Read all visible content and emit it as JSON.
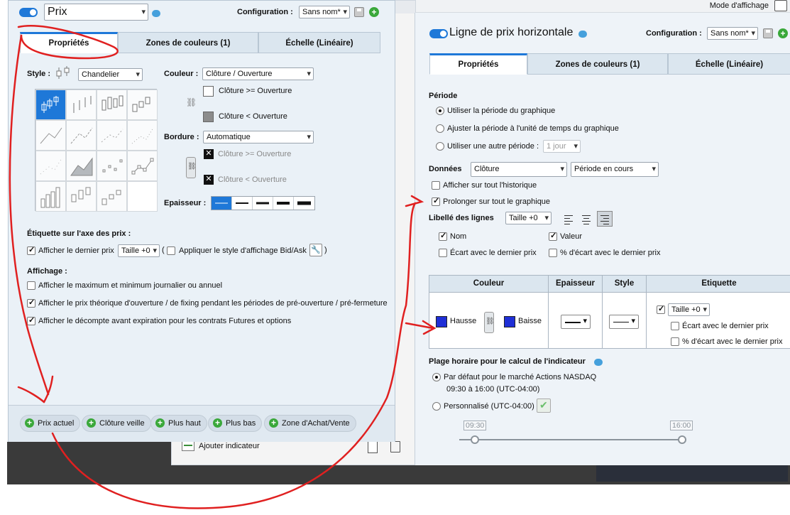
{
  "top_strip": {
    "mode_label": "Mode d'affichage"
  },
  "back_panel": {
    "add_indicator_label": "Ajouter indicateur"
  },
  "left_dialog": {
    "title": "Prix",
    "config_label": "Configuration :",
    "config_value": "Sans nom*",
    "tabs": [
      {
        "label": "Propriétés",
        "active": true
      },
      {
        "label": "Zones de couleurs (1)",
        "active": false
      },
      {
        "label": "Échelle (Linéaire)",
        "active": false
      }
    ],
    "style_label": "Style :",
    "style_value": "Chandelier",
    "couleur_label": "Couleur :",
    "couleur_value": "Clôture / Ouverture",
    "color_up_label": "Clôture >= Ouverture",
    "color_down_label": "Clôture < Ouverture",
    "bordure_label": "Bordure :",
    "bordure_value": "Automatique",
    "border_up_label": "Clôture >= Ouverture",
    "border_down_label": "Clôture < Ouverture",
    "epaisseur_label": "Epaisseur :",
    "axis_section_title": "Étiquette sur l'axe des prix :",
    "show_last_price_label": "Afficher le dernier prix",
    "last_price_size": "Taille +0",
    "paren_open": "(",
    "apply_bidask_label": "Appliquer le style d'affichage Bid/Ask",
    "paren_close": ")",
    "affichage_title": "Affichage :",
    "options": [
      {
        "label": "Afficher le maximum et minimum journalier ou annuel",
        "checked": false
      },
      {
        "label": "Afficher le prix théorique d'ouverture / de fixing pendant les périodes de pré-ouverture / pré-fermeture",
        "checked": true
      },
      {
        "label": "Afficher le décompte avant expiration pour les contrats Futures et options",
        "checked": true
      }
    ],
    "bottom_buttons": [
      "Prix actuel",
      "Clôture veille",
      "Plus haut",
      "Plus bas",
      "Zone d'Achat/Vente"
    ]
  },
  "right_dialog": {
    "title": "Ligne de prix horizontale",
    "config_label": "Configuration :",
    "config_value": "Sans nom*",
    "tabs": [
      {
        "label": "Propriétés",
        "active": true
      },
      {
        "label": "Zones de couleurs (1)",
        "active": false
      },
      {
        "label": "Échelle (Linéaire)",
        "active": false
      }
    ],
    "periode_title": "Période",
    "periode_options": [
      {
        "label": "Utiliser la période du graphique",
        "selected": true
      },
      {
        "label": "Ajuster la période à l'unité de temps du graphique",
        "selected": false
      },
      {
        "label": "Utiliser une autre période :",
        "selected": false
      }
    ],
    "other_period_value": "1 jour",
    "donnees_label": "Données",
    "donnees_value": "Clôture",
    "donnees_period_value": "Période en cours",
    "history_label": "Afficher sur tout l'historique",
    "history_checked": false,
    "extend_label": "Prolonger sur tout le graphique",
    "extend_checked": true,
    "libelle_label": "Libellé des lignes",
    "libelle_size": "Taille +0",
    "nom_label": "Nom",
    "valeur_label": "Valeur",
    "ecart_label": "Écart avec le dernier prix",
    "pct_ecart_label": "% d'écart avec le dernier prix",
    "table_headers": [
      "Couleur",
      "Epaisseur",
      "Style",
      "Etiquette"
    ],
    "hausse_label": "Hausse",
    "baisse_label": "Baisse",
    "etiquette_size": "Taille +0",
    "etiquette_ecart_label": "Écart avec le dernier prix",
    "etiquette_pct_label": "% d'écart avec le dernier prix",
    "plage_title": "Plage horaire pour le calcul de l'indicateur",
    "default_market_label": "Par défaut pour le marché Actions NASDAQ",
    "default_hours": "09:30 à 16:00 (UTC-04:00)",
    "custom_label": "Personnalisé (UTC-04:00)",
    "start_time": "09:30",
    "end_time": "16:00"
  },
  "colors": {
    "accent": "#1e78d8",
    "annotation_red": "#e02020",
    "up_down_blue": "#1f2fd6"
  }
}
